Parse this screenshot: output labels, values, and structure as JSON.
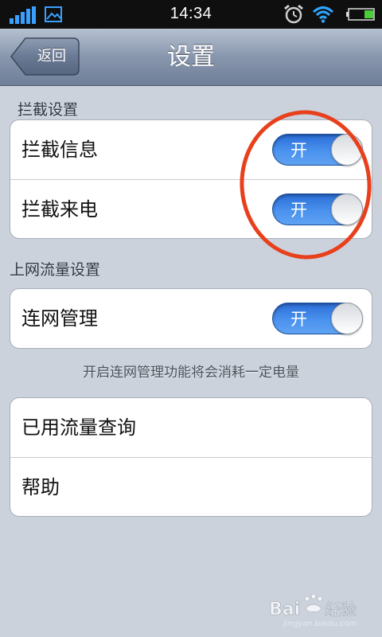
{
  "status_bar": {
    "time": "14:34",
    "icons": [
      "signal-icon",
      "gallery-icon",
      "alarm-icon",
      "wifi-icon",
      "battery-icon"
    ],
    "battery_level": 0.35
  },
  "nav": {
    "back_label": "返回",
    "title": "设置"
  },
  "sections": {
    "intercept": {
      "header": "拦截设置",
      "rows": [
        {
          "label": "拦截信息",
          "toggle": "开",
          "on": true
        },
        {
          "label": "拦截来电",
          "toggle": "开",
          "on": true
        }
      ]
    },
    "traffic": {
      "header": "上网流量设置",
      "rows": [
        {
          "label": "连网管理",
          "toggle": "开",
          "on": true
        }
      ],
      "note": "开启连网管理功能将会消耗一定电量"
    },
    "other": {
      "rows": [
        {
          "label": "已用流量查询"
        },
        {
          "label": "帮助"
        }
      ]
    }
  },
  "colors": {
    "toggle_on": "#3d86e8",
    "annotation_circle": "#e8401c",
    "background": "#cbd2dc"
  }
}
